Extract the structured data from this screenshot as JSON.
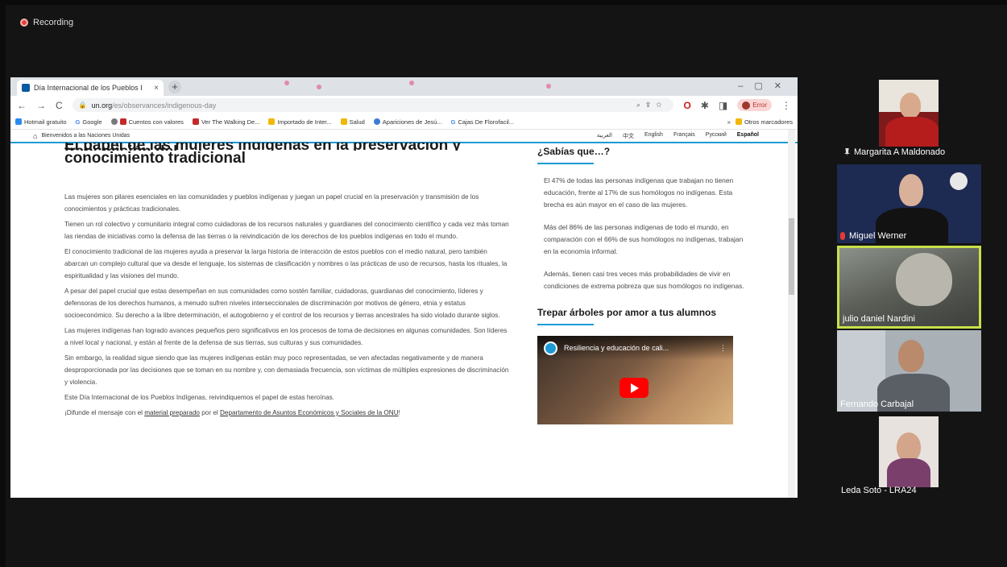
{
  "recording": {
    "label": "Recording"
  },
  "browser": {
    "tab_title": "Día Internacional de los Pueblos I",
    "url_host": "un.org",
    "url_path": "/es/observances/indigenous-day",
    "profile_label": "Error",
    "bookmarks": [
      "Hotmail gratuito",
      "Google",
      "Cuentos con valores",
      "Ver The Walking De...",
      "Importado de Inter...",
      "Salud",
      "Apariciones de Jesú...",
      "Cajas De Florofacil..."
    ],
    "other_bookmarks": "Otros marcadores"
  },
  "site": {
    "welcome": "Bienvenidos a las Naciones Unidas",
    "languages": [
      "العربية",
      "中文",
      "English",
      "Français",
      "Русский",
      "Español"
    ]
  },
  "article": {
    "title_cut": "El papel de las mujeres indígenas en la preservación y transmisión del",
    "title": "conocimiento tradicional",
    "paragraphs": [
      "Las mujeres son pilares esenciales en las comunidades y pueblos indígenas y juegan un papel crucial en la preservación y transmisión de los conocimientos y prácticas tradicionales.",
      "Tienen un rol colectivo y comunitario integral como cuidadoras de los recursos naturales y guardianes del conocimiento científico y cada vez más toman las riendas de iniciativas como la defensa de las tierras o la reivindicación de los derechos de los pueblos indígenas en todo el mundo.",
      "El conocimiento tradicional de las mujeres ayuda a preservar la larga historia de interacción de estos pueblos con el medio natural, pero también abarcan un complejo cultural que va desde el lenguaje, los sistemas de clasificación y nombres o las prácticas de uso de recursos, hasta los rituales, la espiritualidad y las visiones del mundo.",
      "A pesar del papel crucial que estas desempeñan en sus comunidades como sostén familiar, cuidadoras, guardianas del conocimiento, líderes y defensoras de los derechos humanos, a menudo sufren niveles interseccionales de discriminación por motivos de género, etnia y estatus socioeconómico. Su derecho a la libre determinación, el autogobierno y el control de los recursos y tierras ancestrales ha sido violado durante siglos.",
      "Las mujeres indígenas han logrado avances pequeños pero significativos en los procesos de toma de decisiones en algunas comunidades. Son líderes a nivel local y nacional, y están al frente de la defensa de sus tierras, sus culturas y sus comunidades.",
      "Sin embargo, la realidad sigue siendo que las mujeres indígenas están muy poco representadas, se ven afectadas negativamente y de manera desproporcionada por las decisiones que se toman en su nombre y, con demasiada frecuencia, son víctimas de múltiples expresiones de discriminación y violencia.",
      "Este Día Internacional de los Pueblos Indígenas, reivindiquemos el papel de estas heroínas."
    ],
    "cta_prefix": "¡Difunde el mensaje con el ",
    "cta_link1": "material preparado",
    "cta_mid": " por el ",
    "cta_link2": "Departamento de Asuntos Económicos y Sociales de la ONU",
    "cta_suffix": "!"
  },
  "sidebar": {
    "heading": "¿Sabías que…?",
    "facts": [
      "El 47% de todas las personas indígenas que trabajan no tienen educación, frente al 17% de sus homólogos no indígenas. Esta brecha es aún mayor en el caso de las mujeres.",
      "Más del 86% de las personas indígenas de todo el mundo, en comparación con el 66% de sus homólogos no indígenas, trabajan en la economía informal.",
      "Además, tienen casi tres veces más probabilidades de vivir en condiciones de extrema pobreza que sus homólogos no indígenas."
    ],
    "video_heading": "Trepar árboles por amor a tus alumnos",
    "video_title": "Resiliencia y educación de cali..."
  },
  "participants": [
    {
      "name": "Margarita A Maldonado"
    },
    {
      "name": "Miguel Werner"
    },
    {
      "name": "julio daniel Nardini"
    },
    {
      "name": "Fernando Carbajal"
    },
    {
      "name": "Leda Soto - LRA24"
    }
  ],
  "colors": {
    "un_blue": "#1d9ad6",
    "active_speaker": "#c7e04a",
    "mute_red": "#e53935"
  }
}
